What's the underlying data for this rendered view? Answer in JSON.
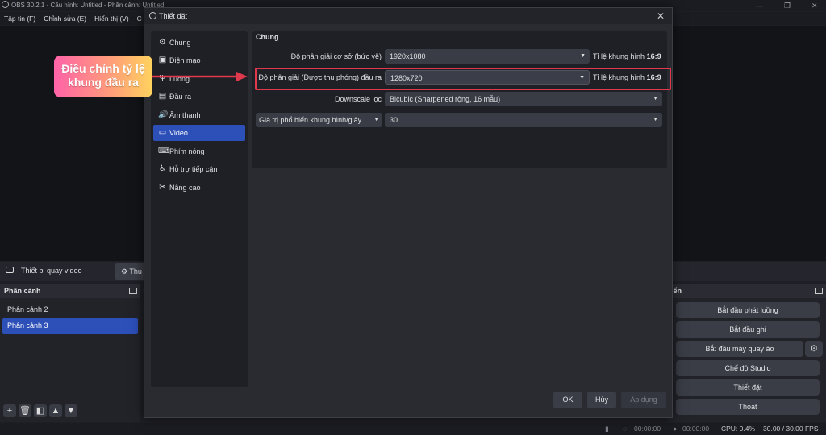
{
  "app": {
    "title": "OBS 30.2.1 - Cấu hình: Untitled - Phân cảnh: Untitled",
    "menu": [
      "Tập tin (F)",
      "Chỉnh sửa (E)",
      "Hiển thị (V)",
      "C"
    ]
  },
  "source_bar": {
    "label": "Thiết bị quay video",
    "props_button": "Thu"
  },
  "scenes": {
    "header": "Phân cảnh",
    "items": [
      "Phân cảnh 2",
      "Phân cảnh 3"
    ],
    "selected": "Phân cảnh 3",
    "tools": [
      "+",
      "🗑",
      "◧",
      "▲",
      "▼"
    ]
  },
  "controls": {
    "header": "iển",
    "buttons": [
      "Bắt đầu phát luồng",
      "Bắt đầu ghi",
      "Bắt đầu máy quay ảo",
      "Chế độ Studio",
      "Thiết đặt",
      "Thoát"
    ]
  },
  "status": {
    "time1": "00:00:00",
    "time2": "00:00:00",
    "cpu": "CPU: 0.4%",
    "fps": "30.00 / 30.00 FPS"
  },
  "dialog": {
    "title": "Thiết đặt",
    "sidebar": [
      {
        "label": "Chung",
        "icon": "gear-icon",
        "glyph": "⚙"
      },
      {
        "label": "Diện mạo",
        "icon": "appearance-icon",
        "glyph": "▣"
      },
      {
        "label": "Luồng",
        "icon": "antenna-icon",
        "glyph": "Ψ"
      },
      {
        "label": "Đầu ra",
        "icon": "output-icon",
        "glyph": "▤"
      },
      {
        "label": "Âm thanh",
        "icon": "speaker-icon",
        "glyph": "🔊"
      },
      {
        "label": "Video",
        "icon": "monitor-icon",
        "glyph": "▭"
      },
      {
        "label": "Phím nóng",
        "icon": "keyboard-icon",
        "glyph": "⌨"
      },
      {
        "label": "Hỗ trợ tiếp cận",
        "icon": "accessibility-icon",
        "glyph": "♿"
      },
      {
        "label": "Nâng cao",
        "icon": "tools-icon",
        "glyph": "✂"
      }
    ],
    "selected": "Video",
    "panel_title": "Chung",
    "base_resolution": {
      "label": "Độ phân giải cơ sở (bức vẽ)",
      "value": "1920x1080",
      "aspect_label": "Tỉ lệ khung hình",
      "aspect_value": "16:9"
    },
    "output_resolution": {
      "label": "Độ phân giải (Được thu phóng) đầu ra",
      "value": "1280x720",
      "aspect_label": "Tỉ lệ khung hình",
      "aspect_value": "16:9"
    },
    "downscale": {
      "label": "Downscale lọc",
      "value": "Bicubic (Sharpened rộng, 16 mẫu)"
    },
    "fps": {
      "label": "Giá trị phổ biến khung hình/giây",
      "value": "30"
    },
    "buttons": {
      "ok": "OK",
      "cancel": "Hủy",
      "apply": "Áp dụng"
    }
  },
  "annotation": {
    "text_line1": "Điều chỉnh tỷ lệ",
    "text_line2": "khung đầu ra",
    "colors": {
      "box_border": "#e0384c",
      "arrow": "#e0384c"
    }
  }
}
